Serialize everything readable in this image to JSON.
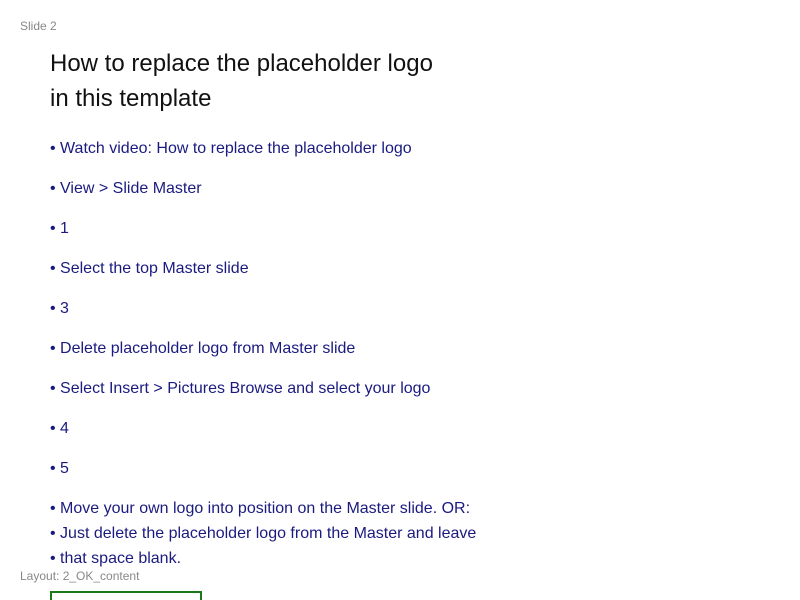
{
  "slide": {
    "label": "Slide 2",
    "title_line1": "How to replace the placeholder logo",
    "title_line2": "in this template",
    "bullets": [
      "• Watch video: How to replace the placeholder logo",
      "• View > Slide Master",
      "• 1",
      "• Select the top Master slide",
      "• 3",
      "• Delete placeholder logo from Master slide",
      "• Select Insert > Pictures Browse and select your logo",
      "• 4",
      "• 5",
      "• Move your own logo into position on the Master slide. OR:",
      "• Just delete the placeholder logo from the Master and leave",
      "• that space blank."
    ]
  },
  "footer": {
    "layout_label": "Layout: 2_OK_content"
  },
  "colors": {
    "bullet_text": "#1a1a80",
    "title_text": "#111111",
    "muted_label": "#888888",
    "box_border": "#1a7a1a"
  }
}
